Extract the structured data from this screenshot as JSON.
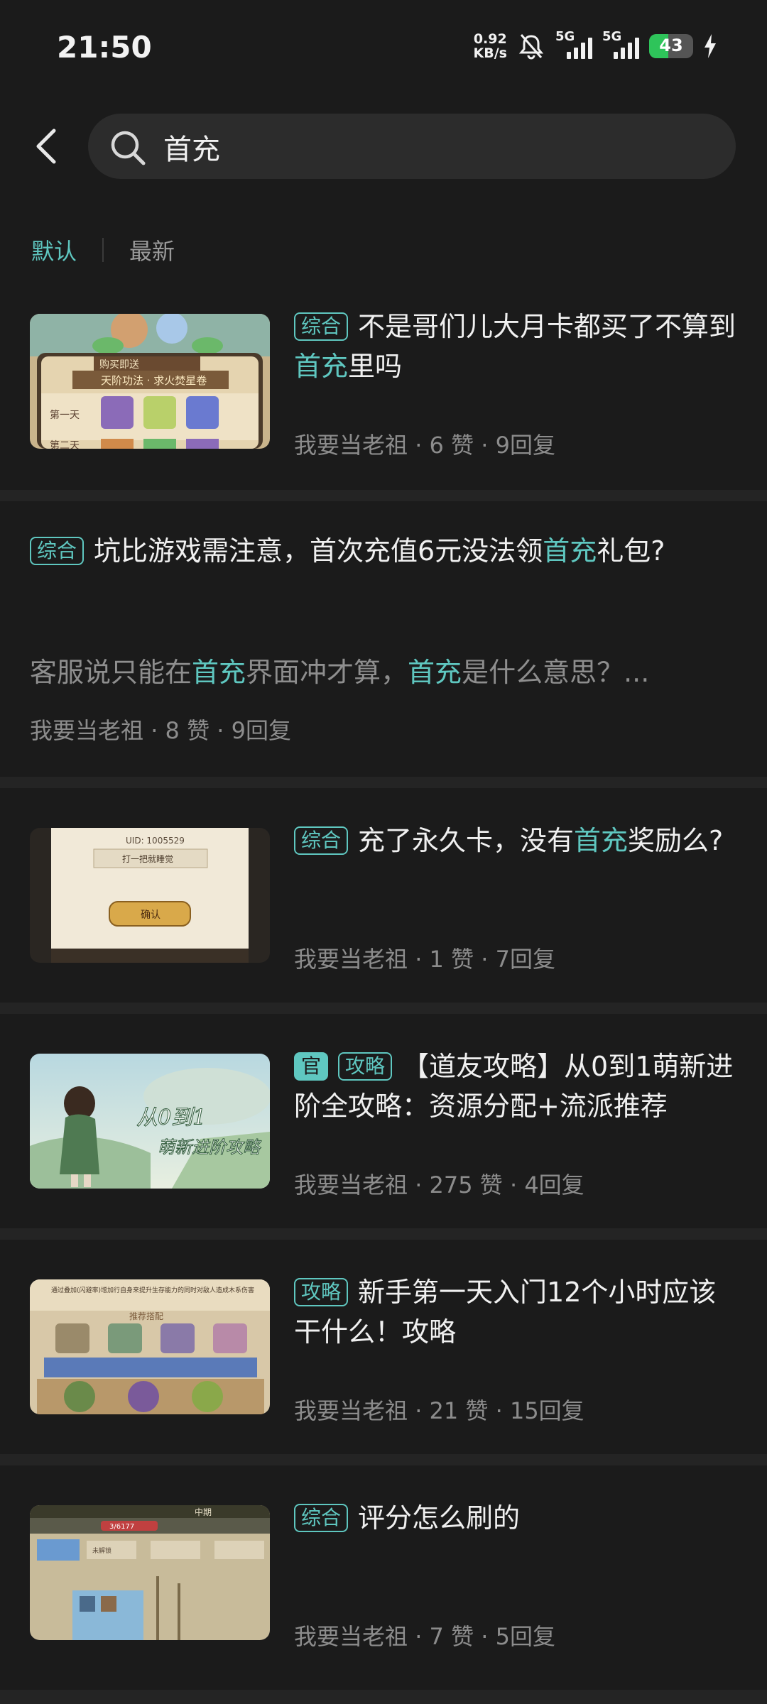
{
  "status_bar": {
    "time": "21:50",
    "net_speed_value": "0.92",
    "net_speed_unit": "KB/s",
    "sim1_label": "5G",
    "sim2_label": "5G",
    "battery_level": "43",
    "battery_percent": 43,
    "mute_icon": "bell-slash-icon",
    "charging_icon": "bolt-icon"
  },
  "search": {
    "query": "首充",
    "back_icon": "chevron-left-icon",
    "search_icon": "magnifier-icon"
  },
  "sort": {
    "options": [
      "默认",
      "最新"
    ],
    "active": "默认"
  },
  "colors": {
    "accent": "#5fc7c0",
    "background": "#1b1b1b",
    "separator": "#242424"
  },
  "posts": [
    {
      "tag": "综合",
      "title_parts": [
        "不是哥们儿大月卡都买了不算到",
        "首充",
        "里吗"
      ],
      "author": "我要当老祖",
      "likes": "6 赞",
      "replies": "9回复",
      "thumb_texts": [
        "购买即送",
        "天阶功法 · 求火焚星卷",
        "第一天",
        "第二天"
      ]
    },
    {
      "tag": "综合",
      "title_parts": [
        "坑比游戏需注意，首次充值6元没法领",
        "首充",
        "礼包?"
      ],
      "excerpt_parts": [
        "客服说只能在",
        "首充",
        "界面冲才算，",
        "首充",
        "是什么意思？..."
      ],
      "author": "我要当老祖",
      "likes": "8 赞",
      "replies": "9回复"
    },
    {
      "tag": "综合",
      "title_parts": [
        "充了永久卡，没有",
        "首充",
        "奖励么?"
      ],
      "author": "我要当老祖",
      "likes": "1 赞",
      "replies": "7回复",
      "thumb_texts": [
        "UID: 1005529",
        "打一把就睡觉",
        "确认"
      ]
    },
    {
      "official_tag": "官",
      "tag": "攻略",
      "title": "【道友攻略】从0到1萌新进阶全攻略：资源分配+流派推荐",
      "author": "我要当老祖",
      "likes": "275 赞",
      "replies": "4回复",
      "thumb_texts": [
        "从0到1",
        "萌新进阶攻略"
      ]
    },
    {
      "tag": "攻略",
      "title": "新手第一天入门12个小时应该干什么！攻略",
      "author": "我要当老祖",
      "likes": "21 赞",
      "replies": "15回复",
      "thumb_texts": [
        "通过叠加(闪避率)增加行自身来提升生存能力的同时对敌人造成木系伤害",
        "推荐搭配"
      ]
    },
    {
      "tag": "综合",
      "title": "评分怎么刷的",
      "author": "我要当老祖",
      "likes": "7 赞",
      "replies": "5回复",
      "thumb_texts": [
        "中期",
        "3/6177",
        "未解锁"
      ]
    }
  ]
}
